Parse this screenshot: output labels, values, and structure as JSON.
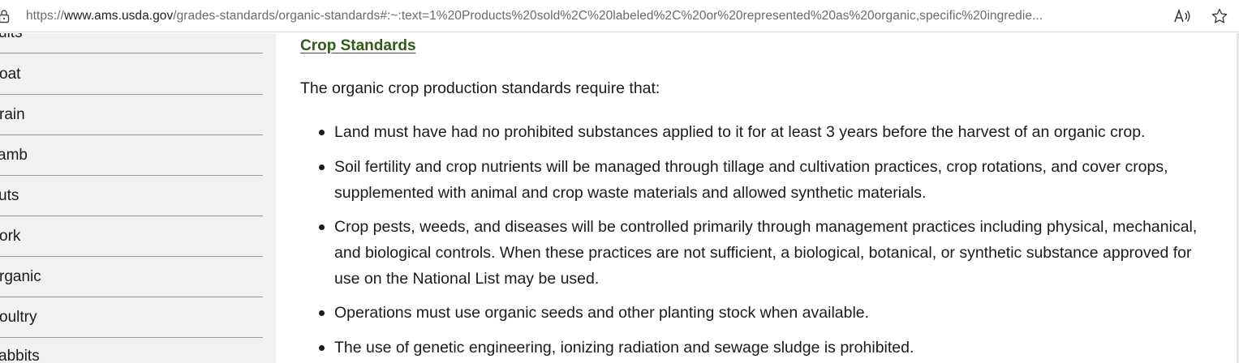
{
  "browser": {
    "url_scheme": "https://",
    "url_host": "www.ams.usda.gov",
    "url_rest": "/grades-standards/organic-standards#:~:text=1%20Products%20sold%2C%20labeled%2C%20or%20represented%20as%20organic,specific%20ingredie...",
    "icons": [
      "lock-icon",
      "read-aloud-icon",
      "favorite-star-icon"
    ]
  },
  "sidebar": {
    "items": [
      {
        "label": "uits"
      },
      {
        "label": "oat"
      },
      {
        "label": "rain"
      },
      {
        "label": "amb"
      },
      {
        "label": "uts"
      },
      {
        "label": "ork"
      },
      {
        "label": "rganic"
      },
      {
        "label": "oultry"
      },
      {
        "label": "abbits"
      }
    ]
  },
  "main": {
    "heading": "Crop Standards",
    "intro": "The organic crop production standards require that:",
    "bullets": [
      {
        "line1": "Land must have had no prohibited substances applied to it for at least 3 years before the harvest of an organic crop."
      },
      {
        "line1": "Soil fertility and crop nutrients will be managed through tillage and cultivation practices, crop rotations, and cover crops,",
        "line2": "supplemented with animal and crop waste materials and allowed synthetic materials."
      },
      {
        "line1": "Crop pests, weeds, and diseases will be controlled primarily through management practices including physical, mechanical,",
        "line2": "and biological controls. When these practices are not sufficient, a biological, botanical, or synthetic substance approved for",
        "line3": "use on the National List may be used."
      },
      {
        "line1": "Operations must use organic seeds and other planting stock when available."
      },
      {
        "line1": "The use of genetic engineering, ionizing radiation and sewage sludge is prohibited."
      }
    ]
  },
  "colors": {
    "heading_green": "#2e5b16",
    "sidebar_bg": "#f1f1f1",
    "text": "#1b1b1b"
  }
}
